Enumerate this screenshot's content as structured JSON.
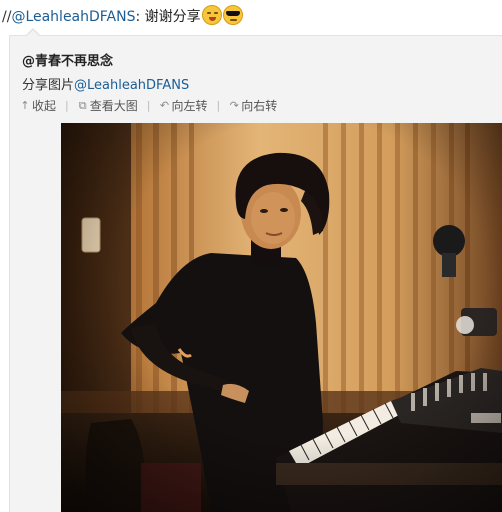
{
  "repost": {
    "prefix": "//",
    "user": "@LeahleahDFANS",
    "message": ": 谢谢分享",
    "emojis": [
      "drool-emoji",
      "sunglasses-emoji"
    ]
  },
  "original": {
    "user": "@青春不再思念",
    "share_text": "分享图片",
    "share_user": "@LeahleahDFANS"
  },
  "actions": [
    {
      "icon": "collapse-arrow-icon",
      "label": "收起"
    },
    {
      "icon": "external-view-icon",
      "label": "查看大图"
    },
    {
      "icon": "rotate-left-icon",
      "label": "向左转"
    },
    {
      "icon": "rotate-right-icon",
      "label": "向右转"
    }
  ],
  "colors": {
    "link": "#1b5d95",
    "panel_bg": "#f3f3f3",
    "photo_warm": "#e0b06a"
  }
}
